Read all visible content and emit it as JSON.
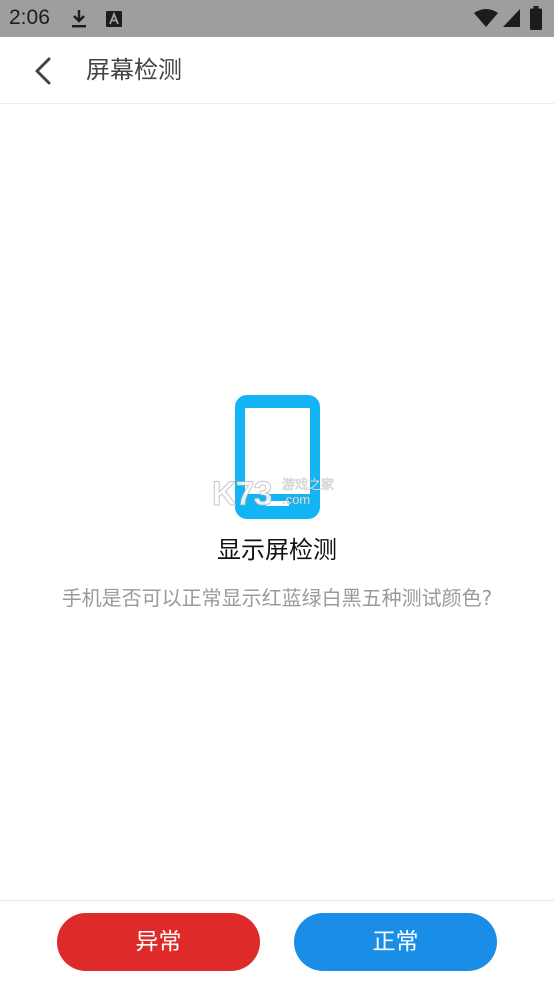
{
  "status_bar": {
    "time": "2:06",
    "icons": [
      "download-icon",
      "font-a-icon",
      "wifi-icon",
      "signal-icon",
      "battery-icon"
    ]
  },
  "header": {
    "title": "屏幕检测",
    "back_icon": "chevron-left-icon"
  },
  "main": {
    "icon": "phone-icon",
    "icon_color": "#12b4f4",
    "title": "显示屏检测",
    "question": "手机是否可以正常显示红蓝绿白黑五种测试颜色?"
  },
  "watermark": {
    "main": "K73",
    "sub": "游戏之家",
    "domain": ".com"
  },
  "buttons": {
    "abnormal_label": "异常",
    "abnormal_color": "#df2a2a",
    "normal_label": "正常",
    "normal_color": "#1a8ee6"
  }
}
